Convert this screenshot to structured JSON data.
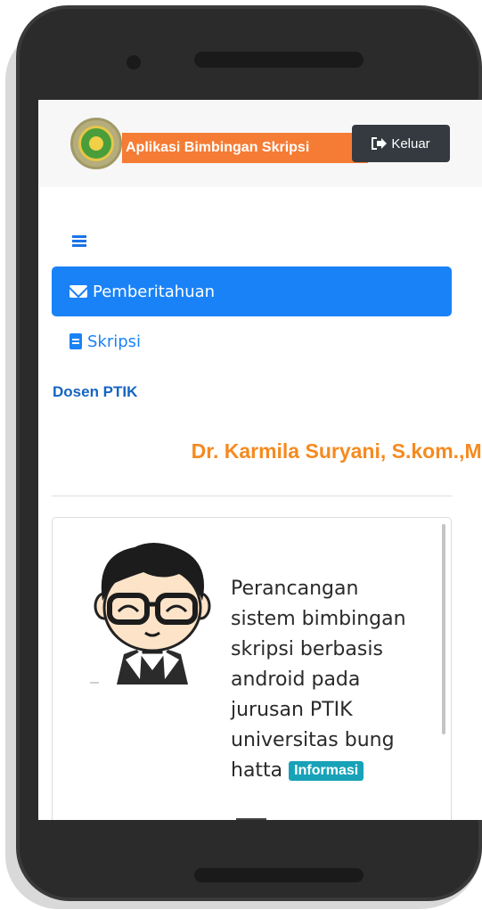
{
  "header": {
    "app_title": "Aplikasi Bimbingan Skripsi",
    "logout_label": "Keluar",
    "logo_icon": "university-seal-icon",
    "logout_icon": "sign-out-icon"
  },
  "nav": {
    "menu_icon": "hamburger-icon",
    "items": [
      {
        "label": "Pemberitahuan",
        "icon": "envelope-icon",
        "active": true
      },
      {
        "label": "Skripsi",
        "icon": "book-icon",
        "active": false
      }
    ]
  },
  "main": {
    "section_label": "Dosen PTIK",
    "lecturer_name": "Dr. Karmila Suryani, S.kom.,M.",
    "card": {
      "avatar_icon": "student-avatar-illustration",
      "thesis_title": "Perancangan sistem bimbingan skripsi berbasis android pada jurusan PTIK universitas bung hatta",
      "badge": "Informasi"
    }
  },
  "colors": {
    "primary": "#1a82f7",
    "brand_orange": "#f57c34",
    "name_orange": "#f58a1f",
    "dark_button": "#343a40",
    "badge_teal": "#17a2b8"
  }
}
